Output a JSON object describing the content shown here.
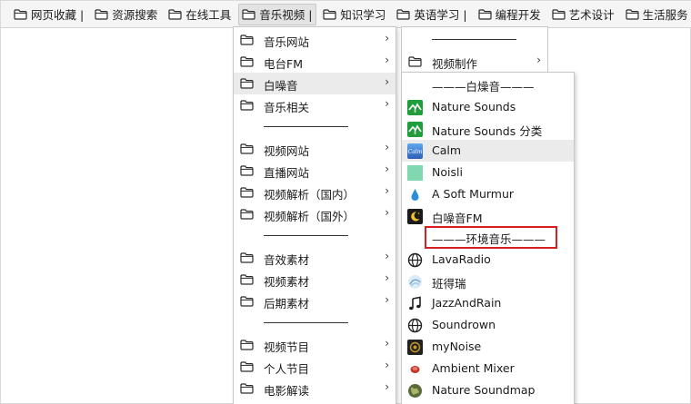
{
  "bookmarks_bar": {
    "items": [
      {
        "label": "网页收藏 |"
      },
      {
        "label": "资源搜索"
      },
      {
        "label": "在线工具"
      },
      {
        "label": "音乐视频 |"
      },
      {
        "label": "知识学习"
      },
      {
        "label": "英语学习 |"
      },
      {
        "label": "编程开发"
      },
      {
        "label": "艺术设计"
      },
      {
        "label": "生活服务"
      }
    ]
  },
  "menu_level1": {
    "items": [
      {
        "label": "音乐网站"
      },
      {
        "label": "电台FM"
      },
      {
        "label": "白噪音"
      },
      {
        "label": "音乐相关"
      },
      {
        "label": "视频网站"
      },
      {
        "label": "直播网站"
      },
      {
        "label": "视频解析（国内）"
      },
      {
        "label": "视频解析（国外）"
      },
      {
        "label": "音效素材"
      },
      {
        "label": "视频素材"
      },
      {
        "label": "后期素材"
      },
      {
        "label": "视频节目"
      },
      {
        "label": "个人节目"
      },
      {
        "label": "电影解读"
      }
    ],
    "arrow": "›"
  },
  "menu_level2": {
    "items": [
      {
        "label": "视频制作"
      }
    ]
  },
  "menu_level3": {
    "header_white_noise": "———白燥音———",
    "header_ambient": "———环境音乐———",
    "items": [
      {
        "label": "Nature Sounds",
        "icon": "nature-sounds-icon",
        "color": "#1f9e3c"
      },
      {
        "label": "Nature Sounds 分类",
        "icon": "nature-sounds-icon",
        "color": "#1f9e3c"
      },
      {
        "label": "Calm",
        "icon": "calm-icon",
        "color": "#3a7bd5"
      },
      {
        "label": "Noisli",
        "icon": "noisli-icon",
        "color": "#7fd8b0"
      },
      {
        "label": "A Soft Murmur",
        "icon": "droplet-icon",
        "color": "#2a8fd6"
      },
      {
        "label": "白噪音FM",
        "icon": "moon-icon",
        "color": "#1b1b1b"
      },
      {
        "label": "LavaRadio",
        "icon": "globe-icon",
        "color": "#222222"
      },
      {
        "label": "班得瑞",
        "icon": "bandari-icon",
        "color": "#6fa8d6"
      },
      {
        "label": "JazzAndRain",
        "icon": "music-note-icon",
        "color": "#222222"
      },
      {
        "label": "Soundrown",
        "icon": "globe-icon",
        "color": "#222222"
      },
      {
        "label": "myNoise",
        "icon": "mynoise-icon",
        "color": "#c79a2a"
      },
      {
        "label": "Ambient Mixer",
        "icon": "ambient-mixer-icon",
        "color": "#c0392b"
      },
      {
        "label": "Nature Soundmap",
        "icon": "earth-icon",
        "color": "#5a6b3a"
      }
    ]
  },
  "colors": {
    "highlight": "#ebebeb",
    "annotation_box": "#d42020"
  }
}
